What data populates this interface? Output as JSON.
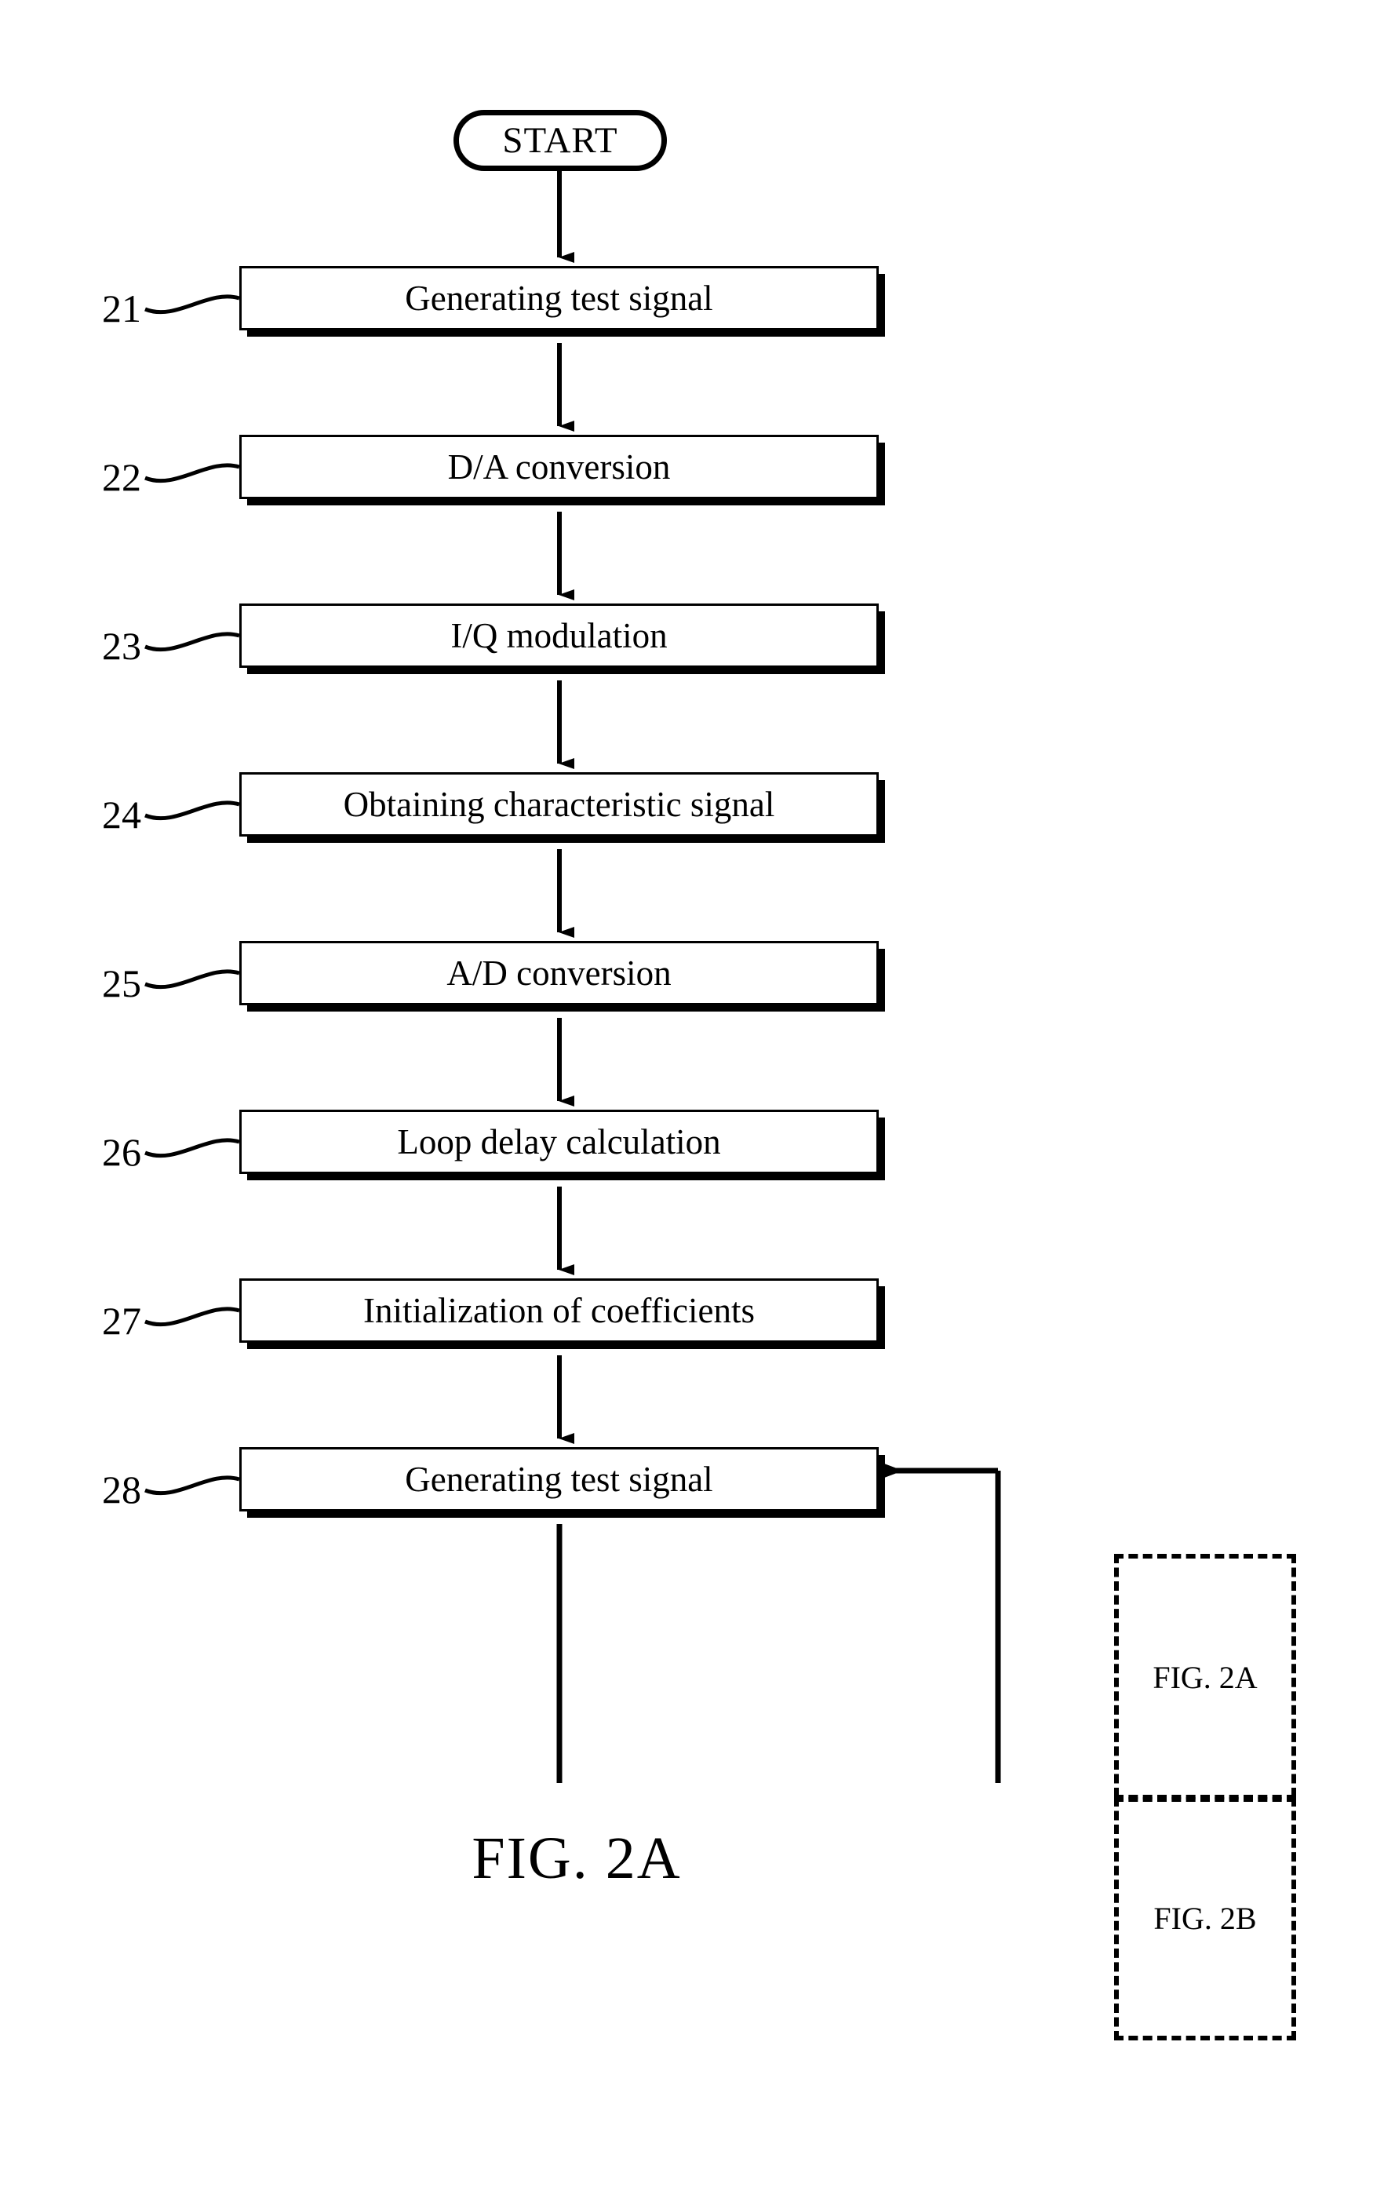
{
  "figure": {
    "caption": "FIG.  2A",
    "start_label": "START"
  },
  "flowchart": {
    "steps": [
      {
        "ref": "21",
        "label": "Generating test signal"
      },
      {
        "ref": "22",
        "label": "D/A conversion"
      },
      {
        "ref": "23",
        "label": "I/Q modulation"
      },
      {
        "ref": "24",
        "label": "Obtaining characteristic signal"
      },
      {
        "ref": "25",
        "label": "A/D conversion"
      },
      {
        "ref": "26",
        "label": "Loop delay calculation"
      },
      {
        "ref": "27",
        "label": "Initialization of coefficients"
      },
      {
        "ref": "28",
        "label": "Generating test signal"
      }
    ]
  },
  "sheet_key": {
    "cells": [
      {
        "label": "FIG. 2A"
      },
      {
        "label": "FIG. 2B"
      }
    ]
  },
  "colors": {
    "ink": "#000000",
    "paper": "#ffffff"
  }
}
